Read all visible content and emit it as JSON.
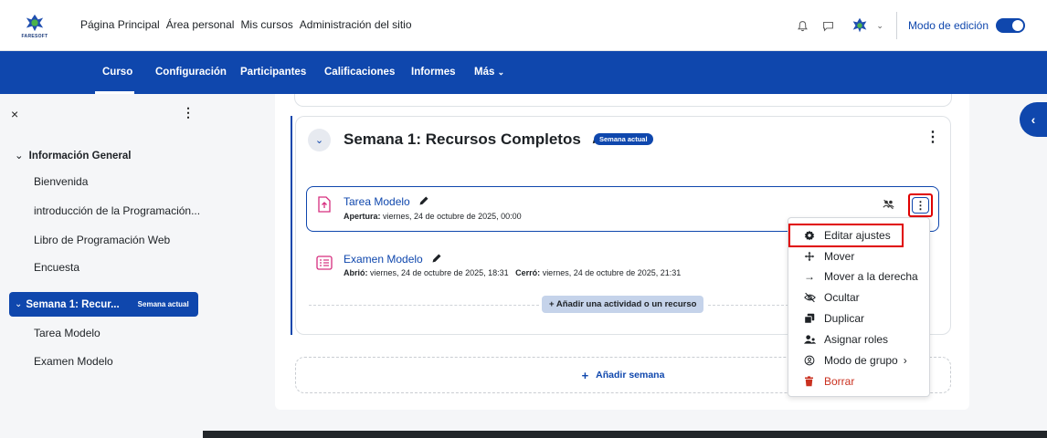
{
  "brand": {
    "logo_text": "FARESOFT"
  },
  "topnav": {
    "items": [
      "Página Principal",
      "Área personal",
      "Mis cursos",
      "Administración del sitio"
    ]
  },
  "top_right": {
    "edit_mode_label": "Modo de edición"
  },
  "secnav": {
    "items": [
      "Curso",
      "Configuración",
      "Participantes",
      "Calificaciones",
      "Informes",
      "Más"
    ],
    "active": "Curso"
  },
  "sidebar": {
    "close_glyph": "×",
    "kebab_glyph": "⋮",
    "section1_title": "Información General",
    "section1_links": [
      "Bienvenida",
      "introducción de la Programación...",
      "Libro de Programación Web",
      "Encuesta"
    ],
    "section2_title": "Semana 1: Recur...",
    "section2_badge": "Semana actual",
    "section2_links": [
      "Tarea Modelo",
      "Examen Modelo"
    ]
  },
  "section": {
    "title": "Semana 1: Recursos Completos",
    "badge": "Semana actual",
    "activities": [
      {
        "name": "Tarea Modelo",
        "info_label": "Apertura:",
        "info_value": "viernes, 24 de octubre de 2025, 00:00"
      },
      {
        "name": "Examen Modelo",
        "info_label1": "Abrió:",
        "info_value1": "viernes, 24 de octubre de 2025, 18:31",
        "info_label2": "Cerró:",
        "info_value2": "viernes, 24 de octubre de 2025, 21:31"
      }
    ],
    "add_activity_label": "+ Añadir una actividad o un recurso"
  },
  "add_week_label": "Añadir semana",
  "dropdown": {
    "items": [
      {
        "label": "Editar ajustes",
        "icon": "gear-icon"
      },
      {
        "label": "Mover",
        "icon": "move-icon"
      },
      {
        "label": "Mover a la derecha",
        "icon": "arrow-right-icon"
      },
      {
        "label": "Ocultar",
        "icon": "eye-slash-icon"
      },
      {
        "label": "Duplicar",
        "icon": "copy-icon"
      },
      {
        "label": "Asignar roles",
        "icon": "users-icon"
      },
      {
        "label": "Modo de grupo",
        "icon": "group-mode-icon"
      },
      {
        "label": "Borrar",
        "icon": "trash-icon"
      }
    ]
  },
  "colors": {
    "primary": "#0f47ad",
    "danger": "#ca3120",
    "highlight": "#e00000",
    "activity_pink": "#d62d7e"
  }
}
